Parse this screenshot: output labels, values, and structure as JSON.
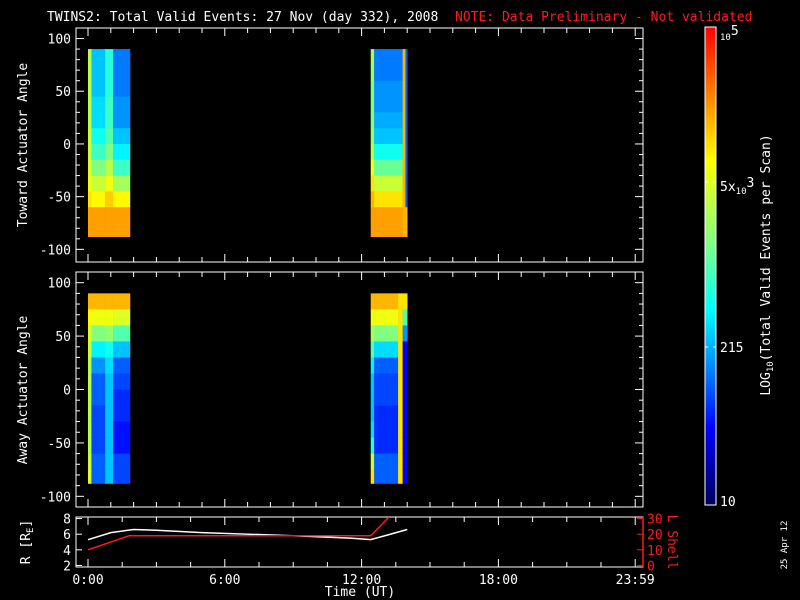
{
  "header": {
    "title": "TWINS2: Total Valid Events: 27 Nov (day 332), 2008",
    "note": "NOTE: Data Preliminary - Not validated",
    "note_color": "#ff1a1a"
  },
  "date_stamp": "25 Apr 12",
  "chart_data": [
    {
      "type": "heatmap",
      "panel": "top",
      "ylabel": "Toward Actuator Angle",
      "ylim": [
        -112,
        110
      ],
      "yticks": [
        "100",
        "50",
        "0",
        "-50",
        "-100"
      ],
      "ytick_values": [
        100,
        50,
        0,
        -50,
        -100
      ],
      "angle_bins_deg": [
        82.5,
        67.5,
        52.5,
        37.5,
        22.5,
        7.5,
        -7.5,
        -22.5,
        -37.5,
        -52.5,
        -67.5,
        -82.5
      ],
      "value_units": "log10 events per scan",
      "columns": [
        {
          "t0": 0.0,
          "t1": 0.15,
          "values": [
            3.5,
            3.5,
            3.5,
            3.5,
            3.5,
            3.6,
            3.6,
            3.7,
            3.8,
            4.0,
            4.3,
            4.3
          ]
        },
        {
          "t0": 0.15,
          "t1": 0.75,
          "values": [
            2.4,
            2.4,
            2.4,
            2.5,
            2.5,
            2.7,
            2.9,
            3.2,
            3.6,
            3.9,
            4.3,
            4.3
          ]
        },
        {
          "t0": 0.75,
          "t1": 1.1,
          "values": [
            2.8,
            2.8,
            2.8,
            2.9,
            2.9,
            3.0,
            3.2,
            3.5,
            3.8,
            4.1,
            4.3,
            4.3
          ]
        },
        {
          "t0": 1.1,
          "t1": 1.84,
          "values": [
            2.1,
            2.1,
            2.1,
            2.2,
            2.2,
            2.4,
            2.6,
            2.9,
            3.4,
            3.9,
            4.3,
            4.3
          ]
        },
        {
          "t0": 12.4,
          "t1": 12.55,
          "values": [
            3.4,
            3.3,
            3.2,
            3.2,
            3.2,
            3.3,
            3.5,
            3.8,
            4.0,
            4.2,
            4.3,
            4.3
          ]
        },
        {
          "t0": 12.55,
          "t1": 13.8,
          "values": [
            2.1,
            2.1,
            2.2,
            2.2,
            2.3,
            2.4,
            2.7,
            3.1,
            3.6,
            4.0,
            4.3,
            4.3
          ]
        },
        {
          "t0": 13.8,
          "t1": 13.92,
          "values": [
            4.2,
            4.2,
            4.2,
            4.2,
            4.2,
            4.2,
            4.2,
            4.2,
            4.2,
            4.2,
            4.2,
            4.2
          ]
        },
        {
          "t0": 13.92,
          "t1": 14.0,
          "values": [
            2.0,
            2.0,
            2.0,
            2.0,
            2.0,
            2.0,
            2.0,
            2.0,
            2.0,
            2.0,
            4.2,
            4.2
          ]
        }
      ]
    },
    {
      "type": "heatmap",
      "panel": "bottom",
      "ylabel": "Away Actuator Angle",
      "ylim": [
        -110,
        110
      ],
      "yticks": [
        "100",
        "50",
        "0",
        "-50",
        "-100"
      ],
      "ytick_values": [
        100,
        50,
        0,
        -50,
        -100
      ],
      "angle_bins_deg": [
        82.5,
        67.5,
        52.5,
        37.5,
        22.5,
        7.5,
        -7.5,
        -22.5,
        -37.5,
        -52.5,
        -67.5,
        -82.5
      ],
      "value_units": "log10 events per scan",
      "columns": [
        {
          "t0": 0.0,
          "t1": 0.15,
          "values": [
            4.2,
            3.9,
            3.7,
            3.6,
            3.5,
            3.5,
            3.5,
            3.5,
            3.5,
            3.5,
            3.6,
            3.7
          ]
        },
        {
          "t0": 0.15,
          "t1": 0.75,
          "values": [
            4.2,
            3.8,
            3.2,
            2.6,
            2.2,
            2.0,
            2.0,
            1.9,
            1.9,
            1.9,
            2.0,
            2.0
          ]
        },
        {
          "t0": 0.75,
          "t1": 1.1,
          "values": [
            4.2,
            3.8,
            3.3,
            2.7,
            2.5,
            2.4,
            2.4,
            2.4,
            2.4,
            2.4,
            2.4,
            2.4
          ]
        },
        {
          "t0": 1.1,
          "t1": 1.84,
          "values": [
            4.2,
            3.7,
            3.0,
            2.4,
            2.0,
            1.9,
            1.8,
            1.8,
            1.7,
            1.7,
            1.9,
            1.9
          ]
        },
        {
          "t0": 12.4,
          "t1": 12.55,
          "values": [
            4.2,
            3.8,
            3.4,
            3.0,
            2.6,
            2.4,
            2.4,
            2.4,
            2.5,
            2.8,
            3.6,
            4.0
          ]
        },
        {
          "t0": 12.55,
          "t1": 13.6,
          "values": [
            4.2,
            3.8,
            3.2,
            2.5,
            2.0,
            1.9,
            1.9,
            1.8,
            1.8,
            1.8,
            2.0,
            2.0
          ]
        },
        {
          "t0": 13.6,
          "t1": 13.8,
          "values": [
            4.0,
            4.0,
            4.0,
            4.0,
            4.0,
            4.0,
            4.0,
            4.0,
            4.0,
            4.0,
            4.0,
            4.0
          ]
        },
        {
          "t0": 13.8,
          "t1": 14.0,
          "values": [
            4.0,
            3.0,
            2.2,
            1.6,
            1.6,
            1.6,
            1.6,
            1.6,
            1.6,
            1.6,
            1.6,
            1.6
          ]
        }
      ]
    },
    {
      "type": "line",
      "panel": "orbit",
      "ylabel_left": {
        "main": "R [R",
        "sub": "E",
        "end": "]"
      },
      "ylabel_right": "L Shell",
      "ylim_left": [
        1.8,
        8.2
      ],
      "ylim_right": [
        -1,
        31
      ],
      "yticks_left": [
        "8",
        "6",
        "4",
        "2"
      ],
      "yticks_left_values": [
        8,
        6,
        4,
        2
      ],
      "yticks_right": [
        "30",
        "20",
        "10",
        "0"
      ],
      "yticks_right_values": [
        30,
        20,
        10,
        0
      ],
      "series": [
        {
          "axis": "left",
          "color": "#ffffff",
          "points": [
            [
              0,
              5.3
            ],
            [
              1,
              6.2
            ],
            [
              2,
              6.6
            ],
            [
              3,
              6.5
            ],
            [
              5,
              6.2
            ],
            [
              7,
              6.0
            ],
            [
              9,
              5.8
            ],
            [
              11.5,
              5.5
            ],
            [
              12.4,
              5.3
            ],
            [
              14,
              6.6
            ]
          ]
        },
        {
          "axis": "right",
          "color": "#ff1a1a",
          "points": [
            [
              0,
              10
            ],
            [
              1.8,
              19
            ],
            [
              12.4,
              19
            ],
            [
              13.2,
              31
            ]
          ]
        }
      ]
    }
  ],
  "time_axis": {
    "label": "Time (UT)",
    "xlim_hours": [
      0,
      24
    ],
    "ticks": [
      "0:00",
      "6:00",
      "12:00",
      "18:00",
      "23:59"
    ],
    "tick_hours": [
      0,
      6,
      12,
      18,
      24
    ]
  },
  "colorbar": {
    "scale": "log",
    "range": [
      10,
      100000
    ],
    "top": {
      "base": "10",
      "exp": "5"
    },
    "mid_high": {
      "pre": "5x",
      "base": "10",
      "exp": "3"
    },
    "mid_low": "215",
    "bottom": "10",
    "label": {
      "pre": "LOG",
      "sub": "10",
      "post": "(Total Valid Events per Scan)"
    },
    "colors": [
      "#00005a",
      "#0000ff",
      "#0080ff",
      "#00ffff",
      "#80ff80",
      "#ffff00",
      "#ff8000",
      "#ff0000"
    ]
  }
}
